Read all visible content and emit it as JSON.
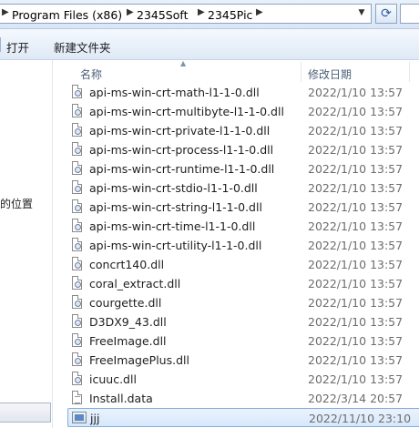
{
  "address_bar": {
    "crumbs": [
      "Program Files (x86)",
      "2345Soft",
      "2345Pic"
    ]
  },
  "toolbar": {
    "open_label": "打开",
    "new_folder_label": "新建文件夹"
  },
  "nav_pane": {
    "truncated_item": "的位置"
  },
  "columns": {
    "name": "名称",
    "modified": "修改日期"
  },
  "files": [
    {
      "name": "api-ms-win-crt-math-l1-1-0.dll",
      "date": "2022/1/10 13:57",
      "icon": "dll-file-icon"
    },
    {
      "name": "api-ms-win-crt-multibyte-l1-1-0.dll",
      "date": "2022/1/10 13:57",
      "icon": "dll-file-icon"
    },
    {
      "name": "api-ms-win-crt-private-l1-1-0.dll",
      "date": "2022/1/10 13:57",
      "icon": "dll-file-icon"
    },
    {
      "name": "api-ms-win-crt-process-l1-1-0.dll",
      "date": "2022/1/10 13:57",
      "icon": "dll-file-icon"
    },
    {
      "name": "api-ms-win-crt-runtime-l1-1-0.dll",
      "date": "2022/1/10 13:57",
      "icon": "dll-file-icon"
    },
    {
      "name": "api-ms-win-crt-stdio-l1-1-0.dll",
      "date": "2022/1/10 13:57",
      "icon": "dll-file-icon"
    },
    {
      "name": "api-ms-win-crt-string-l1-1-0.dll",
      "date": "2022/1/10 13:57",
      "icon": "dll-file-icon"
    },
    {
      "name": "api-ms-win-crt-time-l1-1-0.dll",
      "date": "2022/1/10 13:57",
      "icon": "dll-file-icon"
    },
    {
      "name": "api-ms-win-crt-utility-l1-1-0.dll",
      "date": "2022/1/10 13:57",
      "icon": "dll-file-icon"
    },
    {
      "name": "concrt140.dll",
      "date": "2022/1/10 13:57",
      "icon": "dll-file-icon"
    },
    {
      "name": "coral_extract.dll",
      "date": "2022/1/10 13:57",
      "icon": "dll-file-icon"
    },
    {
      "name": "courgette.dll",
      "date": "2022/1/10 13:57",
      "icon": "dll-file-icon"
    },
    {
      "name": "D3DX9_43.dll",
      "date": "2022/1/10 13:57",
      "icon": "dll-file-icon"
    },
    {
      "name": "FreeImage.dll",
      "date": "2022/1/10 13:57",
      "icon": "dll-file-icon"
    },
    {
      "name": "FreeImagePlus.dll",
      "date": "2022/1/10 13:57",
      "icon": "dll-file-icon"
    },
    {
      "name": "icuuc.dll",
      "date": "2022/1/10 13:57",
      "icon": "dll-file-icon"
    },
    {
      "name": "Install.data",
      "date": "2022/3/14 20:57",
      "icon": "data-file-icon"
    },
    {
      "name": "jjj",
      "date": "2022/11/10 23:10",
      "icon": "display-file-icon",
      "selected": true
    }
  ]
}
